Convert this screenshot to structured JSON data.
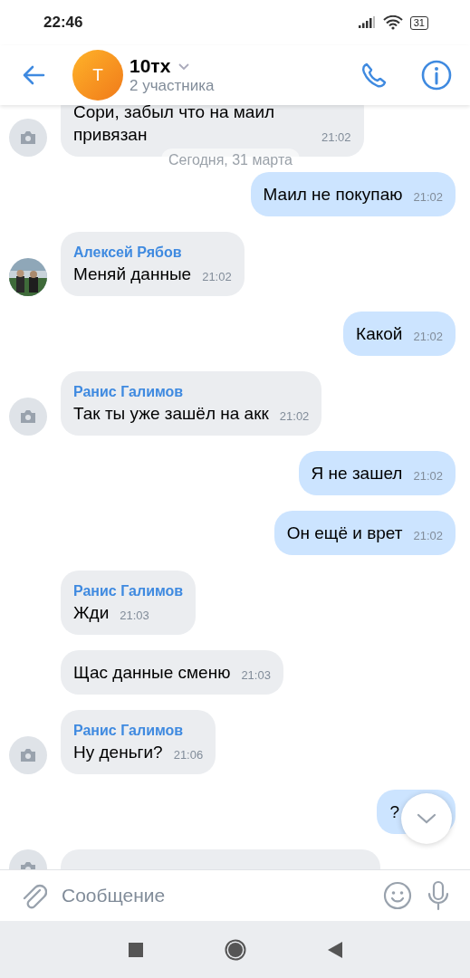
{
  "status_bar": {
    "time": "22:46",
    "battery": "31"
  },
  "header": {
    "avatar_letter": "Т",
    "title": "10тх",
    "subtitle": "2 участника"
  },
  "date_badge": "Сегодня, 31 марта",
  "messages": [
    {
      "kind": "incoming",
      "avatar": {
        "kind": "camera"
      },
      "text": "Сори, забыл что на маил привязан",
      "time": "21:02"
    },
    {
      "kind": "outgoing",
      "text": "Маил не покупаю",
      "time": "21:02"
    },
    {
      "kind": "incoming",
      "sender": "Алексей Рябов",
      "text": "Меняй данные",
      "time": "21:02"
    },
    {
      "kind": "outgoing",
      "text": "Какой",
      "time": "21:02"
    },
    {
      "kind": "incoming",
      "avatar": {
        "kind": "camera"
      },
      "sender": "Ранис Галимов",
      "text": "Так ты уже зашёл на акк",
      "time": "21:02"
    },
    {
      "kind": "outgoing",
      "text": "Я не зашел",
      "time": "21:02"
    },
    {
      "kind": "outgoing",
      "text": "Он ещё и врет",
      "time": "21:02"
    },
    {
      "kind": "incoming",
      "sender": "Ранис Галимов",
      "text": "Жди",
      "time": "21:03"
    },
    {
      "kind": "incoming",
      "text": "Щас данные сменю",
      "time": "21:03"
    },
    {
      "kind": "incoming",
      "avatar": {
        "kind": "camera"
      },
      "sender": "Ранис Галимов",
      "text": "Ну деньги?",
      "time": "21:06"
    },
    {
      "kind": "outgoing",
      "text": "?"
    },
    {
      "kind": "incoming_cut",
      "avatar": {
        "kind": "camera"
      }
    }
  ],
  "composer": {
    "placeholder": "Сообщение"
  }
}
